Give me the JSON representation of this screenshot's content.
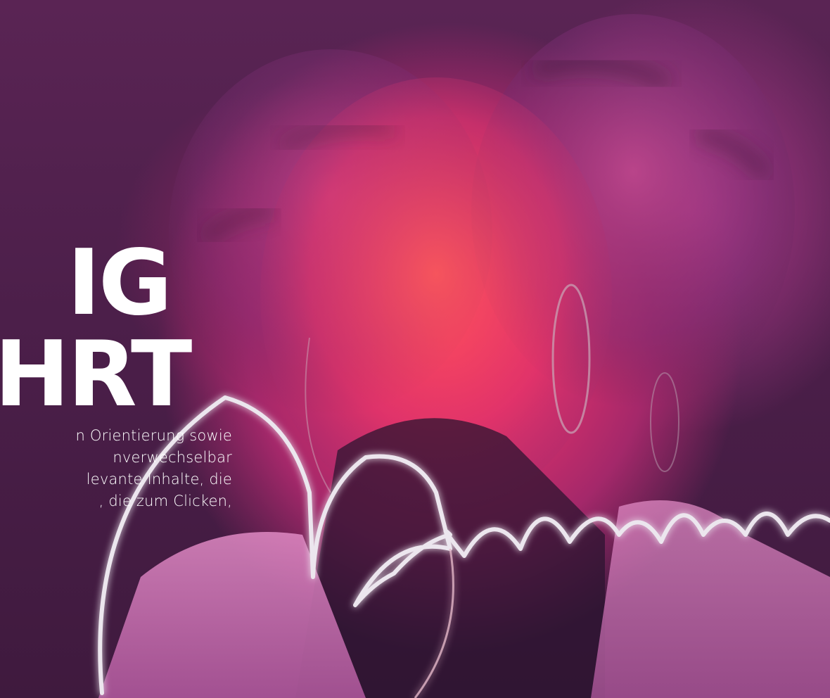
{
  "hero": {
    "headline_line1": "IG",
    "headline_line2": "HRT",
    "body_lines": [
      "n Orientierung sowie",
      "nverwechselbar",
      "levante Inhalte, die",
      ", die zum Clicken,"
    ]
  },
  "colors": {
    "background": "#4a1f48",
    "accent_red": "#ff3a5e",
    "accent_magenta": "#b53a8e",
    "text": "#ffffff",
    "neon_line": "#e8e4ea"
  }
}
